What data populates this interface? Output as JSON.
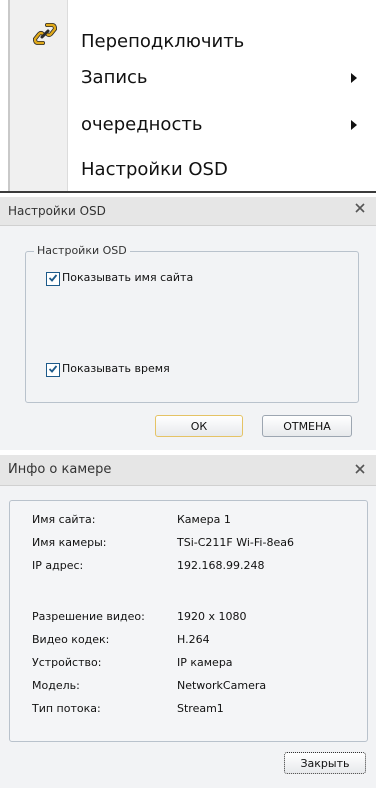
{
  "context_menu": {
    "items": [
      {
        "label": "Переподключить",
        "submenu": false
      },
      {
        "label": "Запись",
        "submenu": true
      },
      {
        "label": "очередность",
        "submenu": true
      },
      {
        "label": "Настройки OSD",
        "submenu": false
      }
    ],
    "icon": "link-icon"
  },
  "osd_dialog": {
    "title": "Настройки OSD",
    "group_label": "Настройки OSD",
    "options": [
      {
        "label": "Показывать имя сайта",
        "checked": true
      },
      {
        "label": "Показывать время",
        "checked": true
      }
    ],
    "ok_label": "ОК",
    "cancel_label": "ОТМЕНА"
  },
  "camera_info": {
    "title": "Инфо о камере",
    "rows": [
      {
        "key": "Имя сайта:",
        "value": "Камера 1"
      },
      {
        "key": "Имя камеры:",
        "value": "TSi-C211F Wi-Fi-8ea6"
      },
      {
        "key": "IP адрес:",
        "value": "192.168.99.248"
      },
      {
        "key": "Разрешение видео:",
        "value": "1920 x 1080"
      },
      {
        "key": "Видео кодек:",
        "value": "H.264"
      },
      {
        "key": "Устройство:",
        "value": "IP камера"
      },
      {
        "key": "Модель:",
        "value": "NetworkCamera"
      },
      {
        "key": "Тип потока:",
        "value": "Stream1"
      }
    ],
    "close_label": "Закрыть"
  },
  "colors": {
    "link_icon": "#d4a012",
    "checkbox_border": "#1d5a8a",
    "ok_border": "#e5c365"
  }
}
